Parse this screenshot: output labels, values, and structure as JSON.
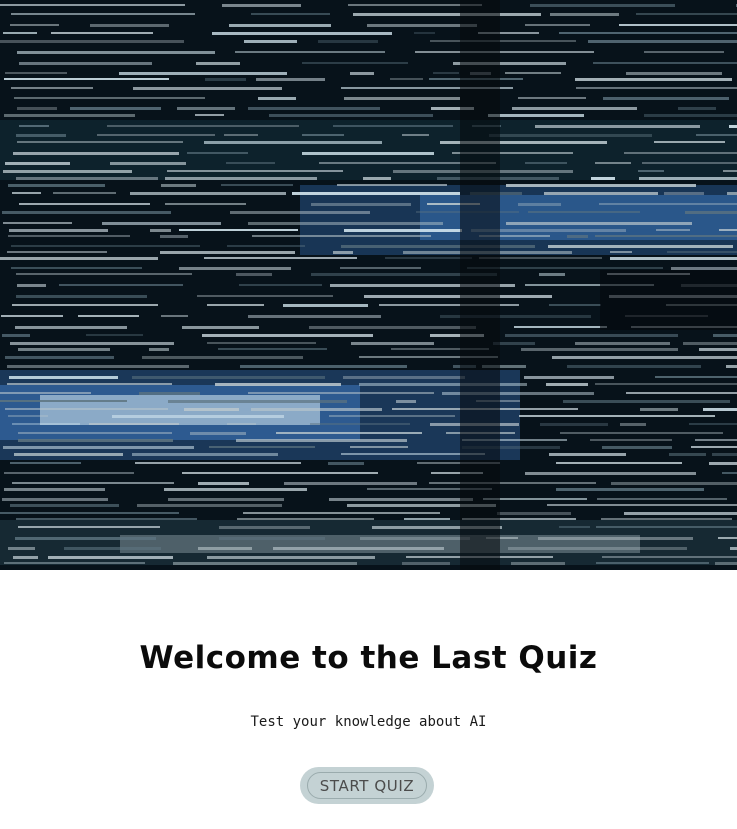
{
  "hero": {
    "image": "glitch-data-stream-video",
    "palette": {
      "background": "#07121a",
      "deep_blue": "#1b3a5c",
      "bright_blue": "#3a72b6",
      "cyan_white": "#d9ecf4",
      "grey_text": "#b9c6cc"
    }
  },
  "welcome": {
    "title": "Welcome to the Last Quiz",
    "subtitle": "Test your knowledge about AI"
  },
  "actions": {
    "start_label": "START QUIZ",
    "start_color": "#c4d2d4"
  }
}
